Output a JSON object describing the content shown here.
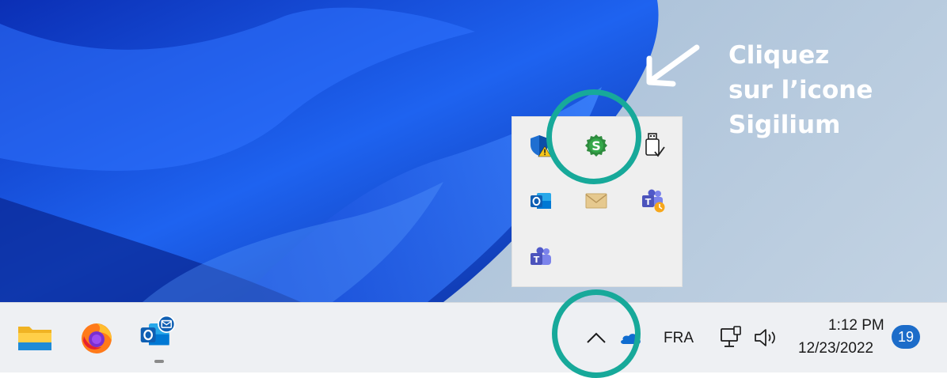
{
  "annotation": {
    "line1": "Cliquez",
    "line2": "sur l’icone",
    "line3": "Sigilium"
  },
  "tray_popup": {
    "icons": [
      "windows-security-warning-icon",
      "sigilium-icon",
      "usb-safely-remove-icon",
      "outlook-icon",
      "mail-envelope-icon",
      "teams-clock-icon",
      "teams-icon"
    ],
    "sigilium_letter": "S"
  },
  "taskbar": {
    "apps": [
      "file-explorer-icon",
      "firefox-icon",
      "outlook-mail-icon"
    ],
    "chevron": "^",
    "language": "FRA",
    "time": "1:12 PM",
    "date": "12/23/2022",
    "notification_count": "19"
  },
  "colors": {
    "highlight_circle": "#17a99a",
    "sigilium_green": "#2e8b3e",
    "taskbar_bg": "#eef0f3",
    "badge": "#1c6cc9"
  }
}
